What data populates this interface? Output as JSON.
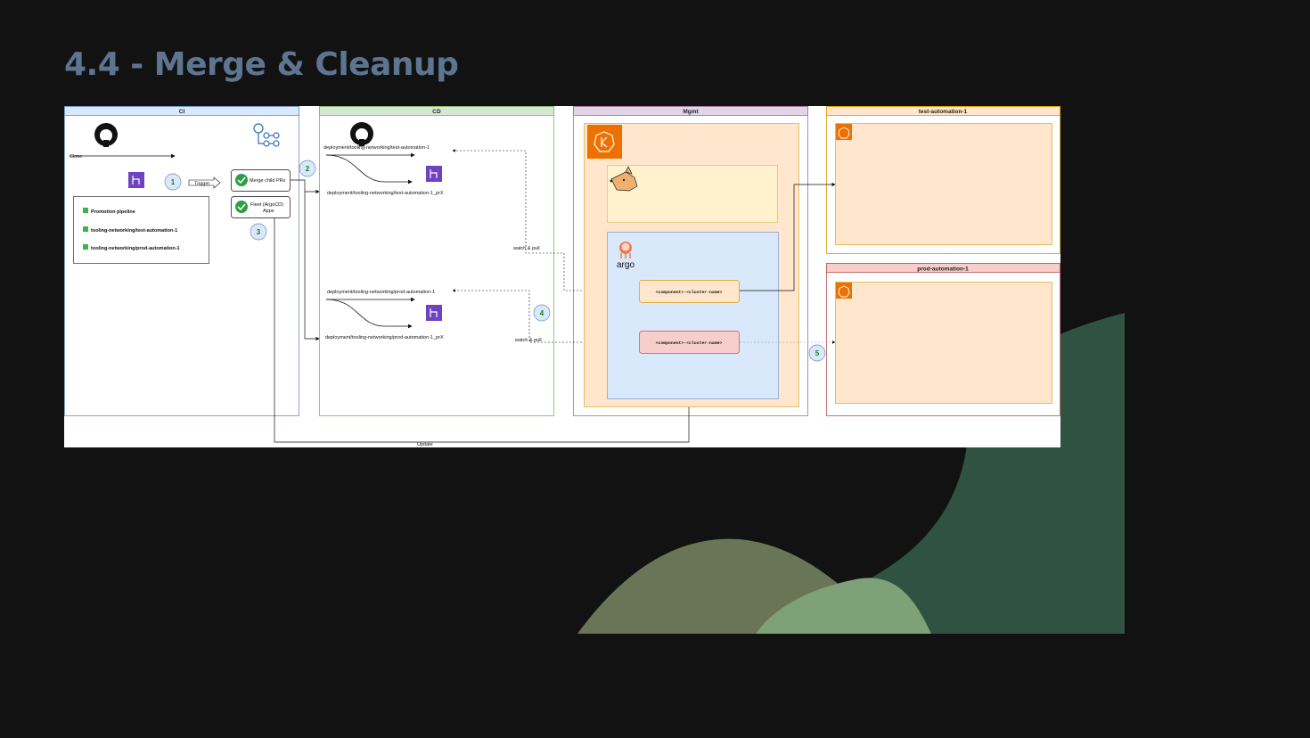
{
  "slide": {
    "title": "4.4 - Merge & Cleanup"
  },
  "colors": {
    "background": "#121212",
    "title": "#5d7591",
    "blob_dark_green": "#2f5242",
    "blob_olive": "#6a7558",
    "blob_light_green": "#7fa178",
    "ci": "#dae8fc",
    "cd": "#d5e8d4",
    "mgmt": "#e1d5e7",
    "test": "#ffe6cc",
    "prod": "#f8cecc"
  },
  "diagram": {
    "lanes": {
      "ci": "CI",
      "cd": "CD",
      "mgmt": "Mgmt",
      "test": "test-automation-1",
      "prod": "prod-automation-1"
    },
    "ci": {
      "clone_label": "Clone",
      "trigger_label": "Trigger",
      "checklist": [
        "Promotion pipeline",
        "tooling-networking/test-automation-1",
        "tooling-networking/prod-automation-1"
      ],
      "merge_box": "Merge child PRs",
      "fleet_box_line1": "Fleet (ArgoCD)",
      "fleet_box_line2": "Apps",
      "update_label": "Update"
    },
    "steps": [
      "1",
      "2",
      "3",
      "4",
      "5"
    ],
    "cd": {
      "test_branch_a": "deployment/tooling-networking/test-automation-1",
      "test_branch_b": "deployment/tooling-networking/test-automation-1_prX",
      "prod_branch_a": "deployment/tooling-networking/prod-automation-1",
      "prod_branch_b": "deployment/tooling-networking/prod-automation-1_prX",
      "watch_pull_test": "watch & pull",
      "watch_pull_prod": "watch & pull"
    },
    "mgmt": {
      "argo_label": "argo",
      "app_test": "<component>-<cluster-name>",
      "app_prod": "<component>-<cluster-name>"
    }
  }
}
